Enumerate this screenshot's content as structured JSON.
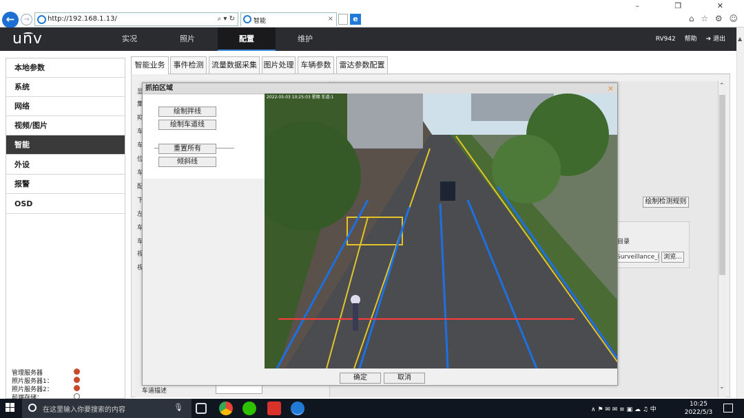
{
  "browser": {
    "url": "http://192.168.1.13/",
    "address_tools": "⌕ ▾ ↻",
    "tab_title": "智能",
    "tab_close": "×",
    "window_controls": "– ❐ ✕",
    "right_icons": "⌂ ☆ ⚙ ☺",
    "back_glyph": "←",
    "fwd_glyph": "→"
  },
  "app": {
    "logo": "unv",
    "nav": [
      "实况",
      "照片",
      "配置",
      "维护"
    ],
    "active_nav": 2,
    "device": "RV942",
    "help": "帮助",
    "logout": "退出",
    "accent": "#3c88d8",
    "header_color": "#2b2c2f"
  },
  "sidebar": {
    "items": [
      "本地参数",
      "系统",
      "网络",
      "视频/图片",
      "智能",
      "外设",
      "报警",
      "OSD"
    ],
    "active_index": 4,
    "servers": [
      {
        "label": "管理服务器",
        "status_color": "#c9492b"
      },
      {
        "label": "照片服务器1：",
        "status_color": "#c9492b"
      },
      {
        "label": "照片服务器2：",
        "status_color": "#c9492b"
      },
      {
        "label": "前端存储：",
        "status_color": "#ffffff"
      }
    ]
  },
  "tabs": [
    "智能业务",
    "事件检测",
    "流量数据采集",
    "图片处理",
    "车辆参数",
    "雷达参数配置"
  ],
  "active_tab": 0,
  "page": {
    "left_chars": [
      "显",
      "集",
      "抑",
      "车",
      "车",
      "位",
      "车",
      "配",
      "下",
      "左",
      "车",
      "车",
      "视",
      "视"
    ],
    "draw_rule_button": "绘制检测规则",
    "dir_label": "目录",
    "dir_value": "Surveillance_I",
    "browse_button": "浏览...",
    "lane_desc": "车道描述"
  },
  "dialog": {
    "title": "抓拍区域",
    "close": "×",
    "buttons": [
      "绘制拌线",
      "绘制车道线",
      "重置所有",
      "倾斜线"
    ],
    "ok": "确定",
    "cancel": "取消",
    "video_osd": "2022-05-03 10:25:03 星期 车道:1",
    "lane_line_color": "#1e6fe0",
    "trip_line_color": "#ff3b3b"
  },
  "taskbar": {
    "search_placeholder": "在这里输入你要搜索的内容",
    "tray": "∧ ⚑ ✉ ✉ ≡ ▣ ☁ ♫ 中",
    "time": "10:25",
    "date": "2022/5/3"
  }
}
